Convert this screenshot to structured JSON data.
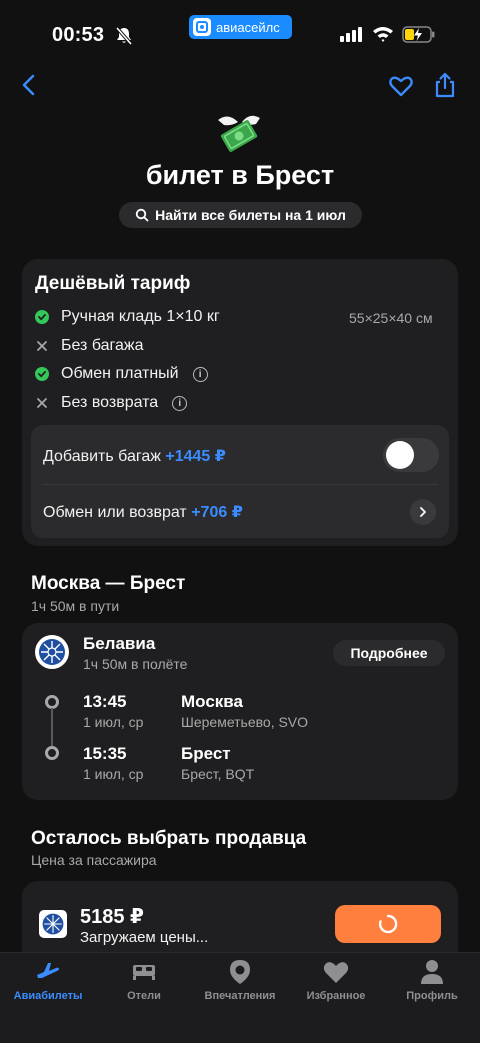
{
  "status_bar": {
    "time": "00:53",
    "app_badge": "авиасейлс"
  },
  "header": {
    "title": "билет в Брест",
    "find_all_label": "Найти все билеты на 1 июл"
  },
  "fare": {
    "title": "Дешёвый тариф",
    "features": [
      {
        "label": "Ручная кладь 1×10 кг",
        "included": true,
        "extra": "55×25×40 см"
      },
      {
        "label": "Без багажа",
        "included": false
      },
      {
        "label": "Обмен платный",
        "included": true
      },
      {
        "label": "Без возврата",
        "included": false
      }
    ],
    "addons": {
      "baggage_label": "Добавить багаж",
      "baggage_price": "+1445 ₽",
      "baggage_enabled": false,
      "exchange_label": "Обмен или возврат",
      "exchange_price": "+706 ₽"
    }
  },
  "route": {
    "title": "Москва — Брест",
    "duration": "1ч 50м в пути",
    "airline": "Белавиа",
    "flight_duration": "1ч 50м в полёте",
    "details_button": "Подробнее",
    "departure": {
      "time": "13:45",
      "date": "1 июл, ср",
      "city": "Москва",
      "airport": "Шереметьево, SVO"
    },
    "arrival": {
      "time": "15:35",
      "date": "1 июл, ср",
      "city": "Брест",
      "airport": "Брест, BQT"
    }
  },
  "seller": {
    "title": "Осталось выбрать продавца",
    "subtitle": "Цена за пассажира",
    "price": "5185 ₽",
    "status": "Загружаем цены..."
  },
  "tabs": [
    {
      "label": "Авиабилеты",
      "icon": "plane-icon",
      "active": true
    },
    {
      "label": "Отели",
      "icon": "bed-icon",
      "active": false
    },
    {
      "label": "Впечатления",
      "icon": "pin-icon",
      "active": false
    },
    {
      "label": "Избранное",
      "icon": "heart-icon",
      "active": false
    },
    {
      "label": "Профиль",
      "icon": "person-icon",
      "active": false
    }
  ],
  "colors": {
    "accent": "#3a8cff",
    "buy": "#ff7f3f",
    "check": "#34c759"
  }
}
